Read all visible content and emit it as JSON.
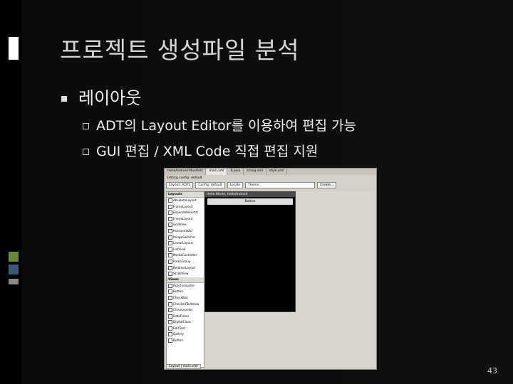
{
  "slide": {
    "title": "프로젝트 생성파일 분석",
    "bullet1": "레이아웃",
    "sub1": "ADT의 Layout Editor를 이용하여 편집 가능",
    "sub2": "GUI 편집 / XML Code 직접 편집 지원",
    "page_number": "43"
  },
  "screenshot": {
    "tabs": [
      "HelloAndroid Manifest",
      "main.xml",
      "R.java",
      "string.xml",
      "style.xml"
    ],
    "config_label": "Editing config: default",
    "toolbar": {
      "layout_value": "Layout: ADT1",
      "config_value": "Config: default",
      "locale_value": "Locale",
      "theme_value": "Theme",
      "create_button": "Create..."
    },
    "palette_layouts_header": "Layouts",
    "palette_layouts": [
      "AbsoluteLayout",
      "FrameLayout",
      "ExpandableListV",
      "FrameLayout",
      "GridView",
      "HorizontalScr",
      "ImageSwitcher",
      "LinearLayout",
      "ListView",
      "MediaController",
      "RadioGroup",
      "RelativeLayout",
      "ScrollView"
    ],
    "palette_views_header": "Views",
    "palette_views": [
      "AutoComplete",
      "Button",
      "CheckBox",
      "CheckedTextView",
      "Chronometer",
      "DatePicker",
      "DigitalClock",
      "EditText",
      "Gallery",
      "Button"
    ],
    "device_title": "Hello World, HelloAndroid",
    "device_button": "Button",
    "bottom_tab": "Layout | main.xml"
  }
}
